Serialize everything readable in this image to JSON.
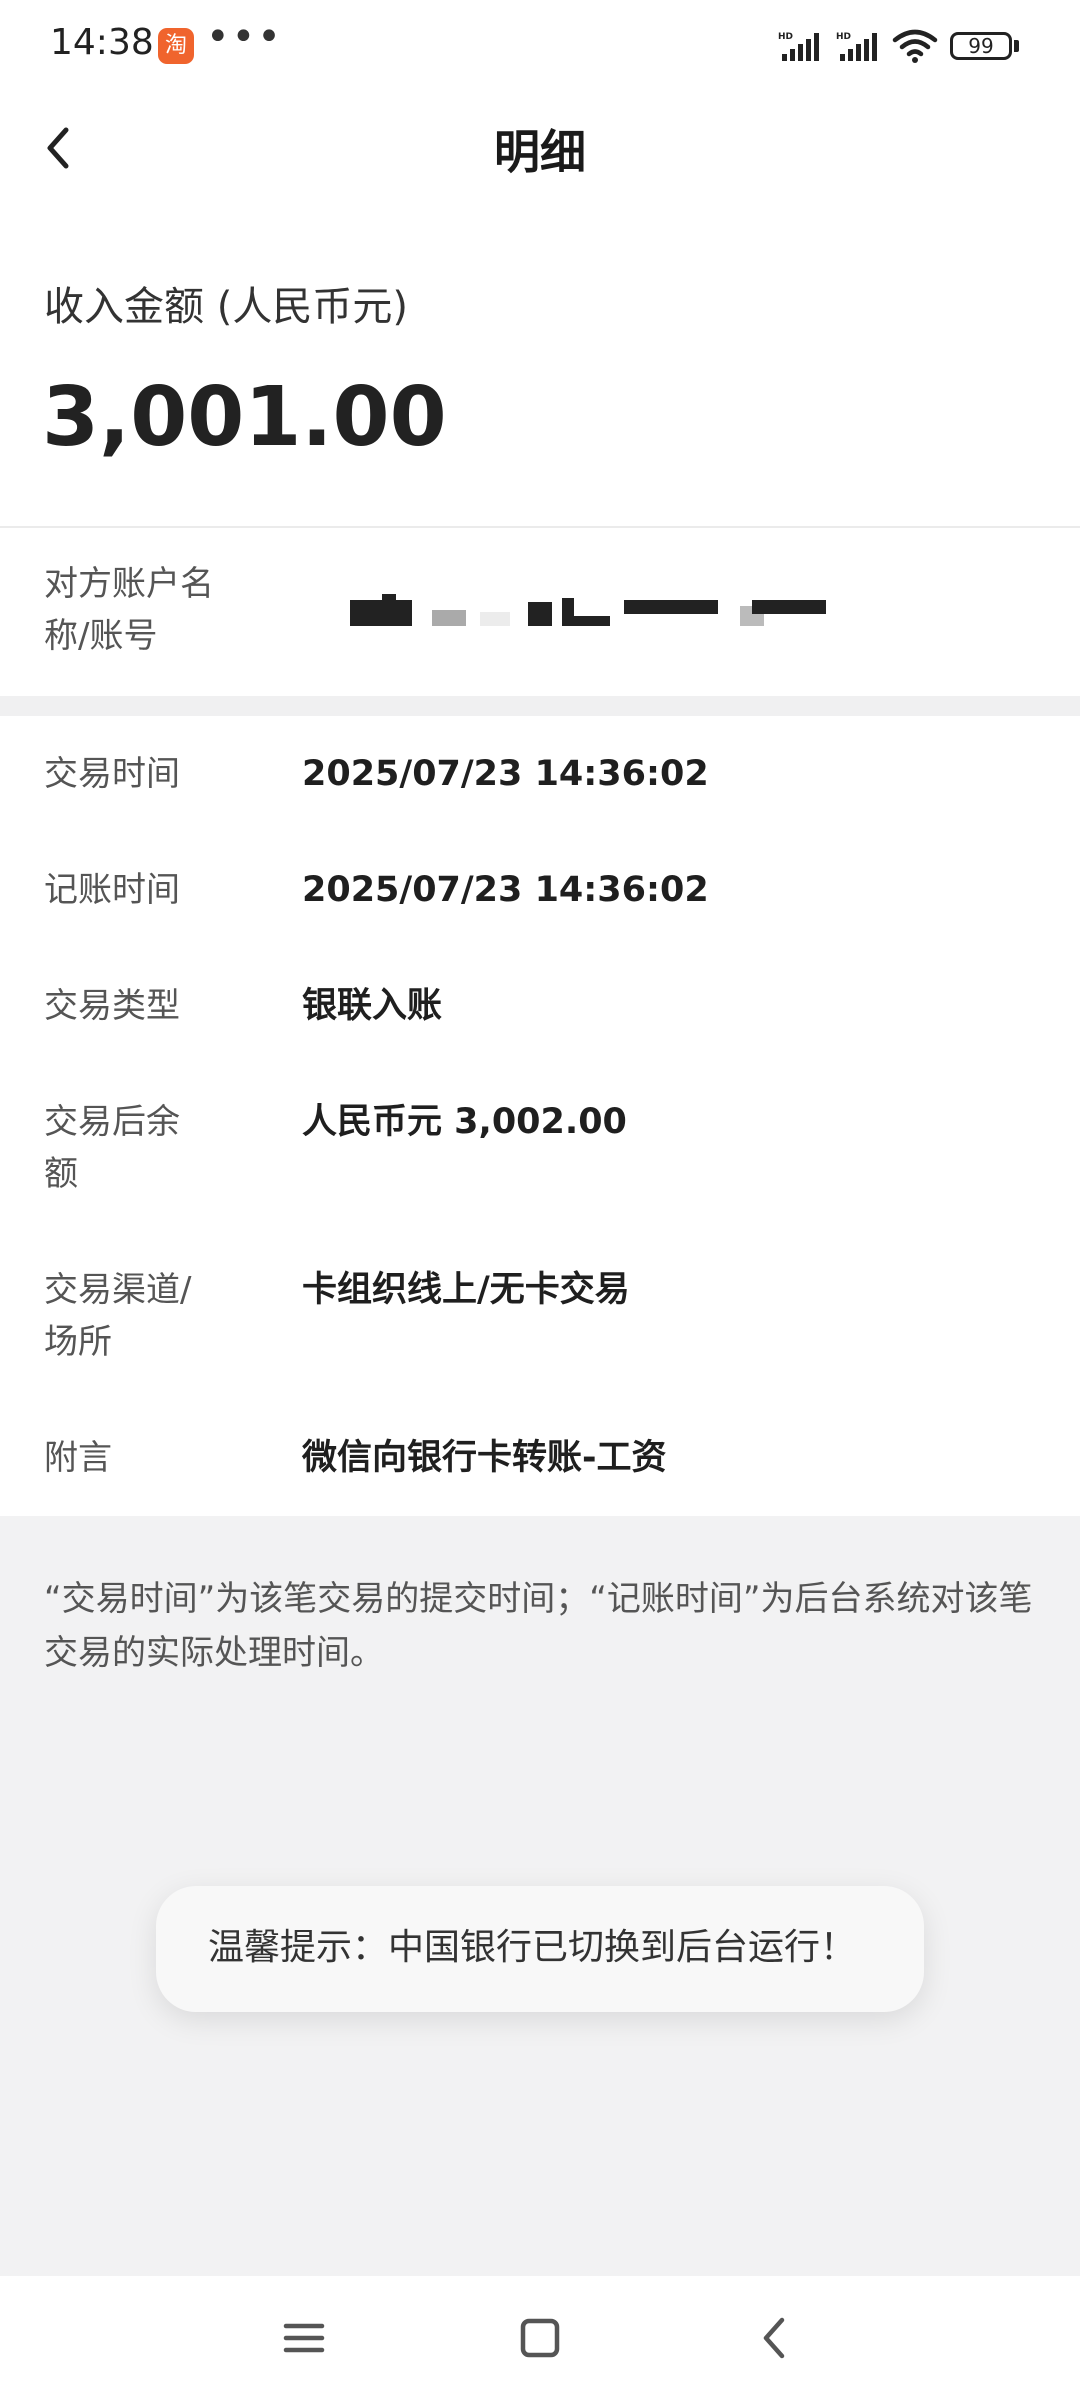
{
  "status_bar": {
    "time": "14:38",
    "app_badge": "淘",
    "more": "•••",
    "battery": "99"
  },
  "header": {
    "title": "明细"
  },
  "amount": {
    "label": "收入金额 (人民币元)",
    "value": "3,001.00"
  },
  "counterparty": {
    "label": "对方账户名称/账号"
  },
  "details": [
    {
      "label": "交易时间",
      "value": "2025/07/23 14:36:02"
    },
    {
      "label": "记账时间",
      "value": "2025/07/23 14:36:02"
    },
    {
      "label": "交易类型",
      "value": "银联入账"
    },
    {
      "label": "交易后余额",
      "value": "人民币元 3,002.00"
    },
    {
      "label": "交易渠道/场所",
      "value": "卡组织线上/无卡交易"
    },
    {
      "label": "附言",
      "value": "微信向银行卡转账-工资"
    }
  ],
  "footnote": "“交易时间”为该笔交易的提交时间；“记账时间”为后台系统对该笔交易的实际处理时间。",
  "toast": "温馨提示：中国银行已切换到后台运行！",
  "colors": {
    "page_background": "#f2f2f3",
    "card_background": "#ffffff",
    "taobao_orange": "#f0642d"
  },
  "icons": {
    "back": "chevron-left-icon",
    "menu": "menu-icon",
    "home": "home-square-icon",
    "nav_back": "nav-back-icon",
    "wifi": "wifi-icon",
    "signal": "signal-icon"
  }
}
